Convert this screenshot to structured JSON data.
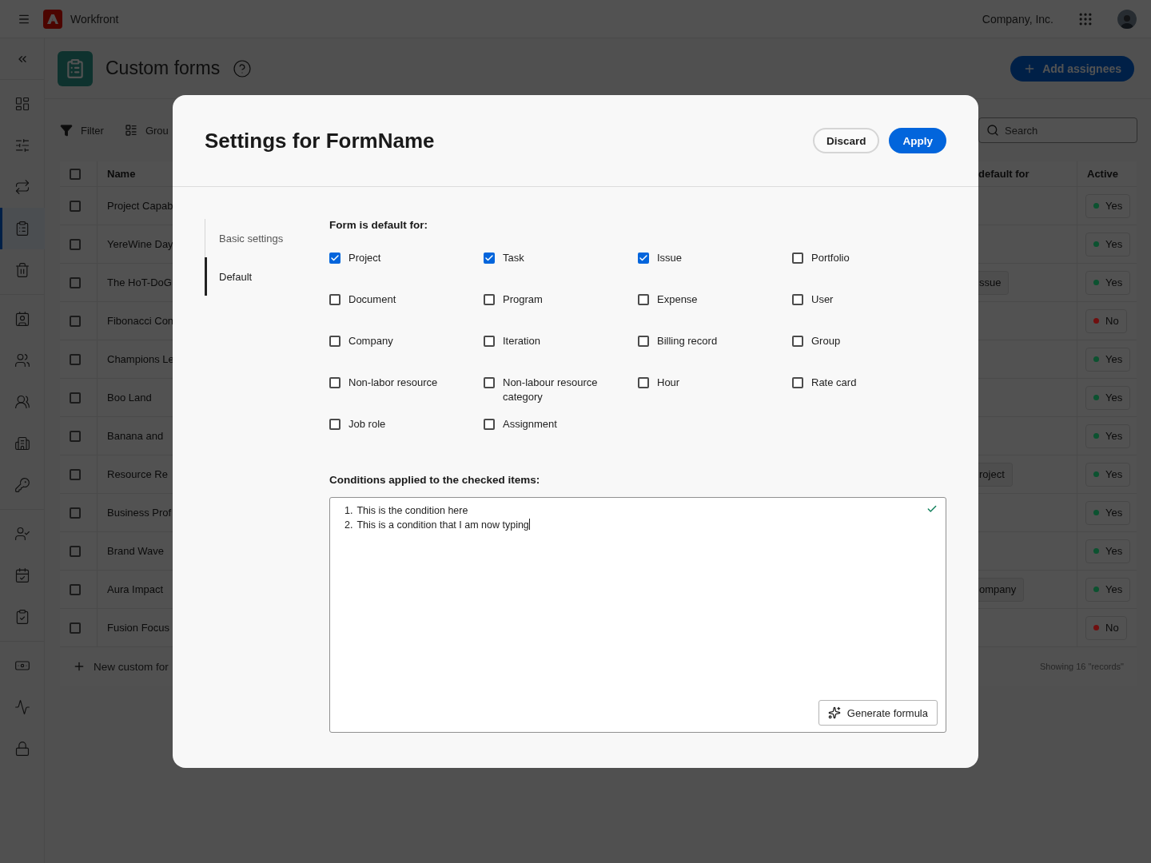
{
  "top_bar": {
    "brand": "Workfront",
    "company": "Company, Inc."
  },
  "rail": {
    "groups": [
      [
        {
          "selected": false
        },
        {
          "selected": false
        },
        {
          "selected": false
        },
        {
          "selected": true
        },
        {
          "selected": false
        }
      ],
      [
        {
          "selected": false
        },
        {
          "selected": false
        },
        {
          "selected": false
        },
        {
          "selected": false
        },
        {
          "selected": false
        }
      ],
      [
        {
          "selected": false
        },
        {
          "selected": false
        },
        {
          "selected": false
        }
      ],
      [
        {
          "selected": false
        },
        {
          "selected": false
        },
        {
          "selected": false
        }
      ]
    ]
  },
  "page": {
    "title": "Custom forms",
    "add_button": "Add assignees"
  },
  "toolbar": {
    "filter": "Filter",
    "group": "Grou",
    "search_placeholder": "Search"
  },
  "table": {
    "select_all_checked": false,
    "columns": {
      "name": "Name",
      "default_for": "default for",
      "active": "Active"
    },
    "rows": [
      {
        "name": "Project Capab",
        "checked": false,
        "default_for": "",
        "active": "Yes",
        "color": "#0c5230"
      },
      {
        "name": "YereWine Day",
        "checked": false,
        "default_for": "",
        "active": "Yes",
        "color": "#0c5230"
      },
      {
        "name": "The HoT-DoG",
        "checked": false,
        "default_for": "ssue",
        "active": "Yes",
        "color": "#0c5230"
      },
      {
        "name": "Fibonacci Con",
        "checked": false,
        "default_for": "",
        "active": "No",
        "color": "#700f0f"
      },
      {
        "name": "Champions Le",
        "checked": false,
        "default_for": "",
        "active": "Yes",
        "color": "#0c5230"
      },
      {
        "name": "Boo Land",
        "checked": false,
        "default_for": "",
        "active": "Yes",
        "color": "#0c5230"
      },
      {
        "name": "Banana and",
        "checked": false,
        "default_for": "",
        "active": "Yes",
        "color": "#0c5230"
      },
      {
        "name": "Resource Re",
        "checked": false,
        "default_for": "roject",
        "active": "Yes",
        "color": "#0c5230"
      },
      {
        "name": "Business Prof",
        "checked": false,
        "default_for": "",
        "active": "Yes",
        "color": "#0c5230"
      },
      {
        "name": "Brand Wave",
        "checked": false,
        "default_for": "",
        "active": "Yes",
        "color": "#0c5230"
      },
      {
        "name": "Aura Impact",
        "checked": false,
        "default_for": "ompany",
        "active": "Yes",
        "color": "#0c5230"
      },
      {
        "name": "Fusion Focus",
        "checked": false,
        "default_for": "",
        "active": "No",
        "color": "#700f0f"
      }
    ],
    "new_button": "New custom for",
    "count": "Showing 16 \"records\""
  },
  "dialog": {
    "title": "Settings for FormName",
    "discard": "Discard",
    "apply": "Apply",
    "nav": [
      {
        "label": "Basic settings",
        "selected": false
      },
      {
        "label": "Default",
        "selected": true
      }
    ],
    "default_heading": "Form is default for:",
    "types": [
      {
        "label": "Project",
        "checked": true
      },
      {
        "label": "Task",
        "checked": true
      },
      {
        "label": "Issue",
        "checked": true
      },
      {
        "label": "Portfolio",
        "checked": false
      },
      {
        "label": "Document",
        "checked": false
      },
      {
        "label": "Program",
        "checked": false
      },
      {
        "label": "Expense",
        "checked": false
      },
      {
        "label": "User",
        "checked": false
      },
      {
        "label": "Company",
        "checked": false
      },
      {
        "label": "Iteration",
        "checked": false
      },
      {
        "label": "Billing record",
        "checked": false
      },
      {
        "label": "Group",
        "checked": false
      },
      {
        "label": "Non-labor resource",
        "checked": false
      },
      {
        "label": "Non-labour resource category",
        "checked": false
      },
      {
        "label": "Hour",
        "checked": false
      },
      {
        "label": "Rate card",
        "checked": false
      },
      {
        "label": "Job role",
        "checked": false
      },
      {
        "label": "Assignment",
        "checked": false
      }
    ],
    "conditions_heading": "Conditions applied to the checked items:",
    "conditions": [
      {
        "number": "1.",
        "text": "This is the condition here"
      },
      {
        "number": "2.",
        "text": "This is a condition that I am now typing"
      }
    ],
    "valid": true,
    "generate_button": "Generate formula"
  }
}
